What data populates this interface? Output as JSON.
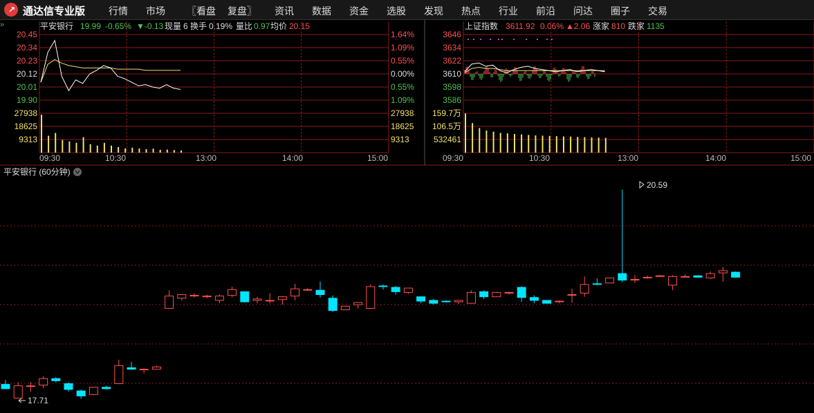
{
  "app": {
    "title": "通达信专业版"
  },
  "menu": [
    "行情",
    "市场",
    "〖看盘",
    "复盘〗",
    "资讯",
    "数据",
    "资金",
    "选股",
    "发现",
    "热点",
    "行业",
    "前沿",
    "问达",
    "圈子",
    "交易"
  ],
  "left_panel": {
    "name": "平安银行",
    "price": "19.99",
    "change_pct": "-0.65%",
    "change": "▼-0.13",
    "vol_label": "现量",
    "vol_value": "6",
    "turnover_label": "换手",
    "turnover_value": "0.19%",
    "ratio_label": "量比",
    "ratio_value": "0.97",
    "avg_label": "均价",
    "avg_value": "20.15",
    "price_ticks": [
      "20.45",
      "20.34",
      "20.23",
      "20.12",
      "20.01",
      "19.90"
    ],
    "pct_ticks": [
      "1.64%",
      "1.09%",
      "0.55%",
      "0.00%",
      "0.55%",
      "1.09%"
    ],
    "vol_ticks": [
      "27938",
      "18625",
      "9313"
    ],
    "time_ticks": [
      "09:30",
      "10:30",
      "13:00",
      "14:00",
      "15:00"
    ]
  },
  "right_panel": {
    "name": "上证指数",
    "value": "3611.92",
    "change_pct": "0.06%",
    "change": "▲2.06",
    "up_label": "涨家",
    "up_value": "810",
    "down_label": "跌家",
    "down_value": "1135",
    "price_ticks": [
      "3646",
      "3634",
      "3622",
      "3610",
      "3598",
      "3586"
    ],
    "vol_ticks": [
      "159.7万",
      "106.5万",
      "532461"
    ],
    "time_ticks": [
      "09:30",
      "10:30",
      "13:00",
      "14:00",
      "15:00"
    ]
  },
  "kline": {
    "title": "平安银行 (60分钟)",
    "high_label": "20.59",
    "low_label": "17.71"
  },
  "colors": {
    "up": "#ff5050",
    "down": "#00e5ff",
    "grid": "#8b1a1a",
    "avg": "#f4e16b",
    "price_line": "#ffffff",
    "green": "#4fc34f"
  },
  "chart_data": [
    {
      "type": "line",
      "title": "平安银行",
      "x": [
        "09:30",
        "09:36",
        "09:42",
        "09:48",
        "09:54",
        "10:00",
        "10:06",
        "10:12",
        "10:18",
        "10:24",
        "10:30",
        "10:36",
        "10:42",
        "10:48",
        "10:54",
        "11:00",
        "11:06",
        "11:12",
        "11:18",
        "11:24",
        "11:30"
      ],
      "series": [
        {
          "name": "price",
          "values": [
            20.05,
            20.3,
            20.4,
            20.1,
            19.98,
            20.07,
            20.04,
            20.12,
            20.15,
            20.19,
            20.17,
            20.1,
            20.08,
            20.05,
            20.02,
            20.03,
            20.01,
            20.0,
            20.03,
            20.0,
            19.99
          ]
        },
        {
          "name": "均价",
          "values": [
            20.05,
            20.2,
            20.24,
            20.21,
            20.19,
            20.18,
            20.17,
            20.17,
            20.17,
            20.17,
            20.17,
            20.16,
            20.16,
            20.16,
            20.16,
            20.15,
            20.15,
            20.15,
            20.15,
            20.15,
            20.15
          ]
        }
      ],
      "volume": [
        27000,
        12000,
        14000,
        9000,
        8000,
        7000,
        11000,
        6000,
        5000,
        7000,
        5000,
        4000,
        3000,
        3500,
        3000,
        2500,
        2800,
        2000,
        2200,
        1800,
        1500
      ],
      "ylim": [
        19.9,
        20.45
      ]
    },
    {
      "type": "line",
      "title": "上证指数",
      "x": [
        "09:30",
        "09:36",
        "09:42",
        "09:48",
        "09:54",
        "10:00",
        "10:06",
        "10:12",
        "10:18",
        "10:24",
        "10:30",
        "10:36",
        "10:42",
        "10:48",
        "10:54",
        "11:00",
        "11:06",
        "11:12",
        "11:18",
        "11:24",
        "11:30"
      ],
      "series": [
        {
          "name": "index",
          "values": [
            3612,
            3619,
            3620,
            3617,
            3618,
            3613,
            3611,
            3614,
            3616,
            3617,
            3615,
            3614,
            3613,
            3612,
            3613,
            3614,
            3612,
            3613,
            3614,
            3613,
            3612
          ]
        },
        {
          "name": "avg",
          "values": [
            3611,
            3615,
            3616,
            3615,
            3615,
            3614,
            3613,
            3613,
            3613,
            3613,
            3613,
            3613,
            3613,
            3613,
            3613,
            3613,
            3613,
            3613,
            3613,
            3613,
            3613
          ]
        }
      ],
      "volume": [
        1590000,
        1200000,
        1000000,
        900000,
        850000,
        800000,
        780000,
        760000,
        740000,
        720000,
        700000,
        690000,
        680000,
        670000,
        660000,
        650000,
        640000,
        630000,
        620000,
        610000,
        600000
      ],
      "ylim": [
        3586,
        3646
      ]
    },
    {
      "type": "candlestick",
      "title": "平安银行 (60分钟)",
      "candles": [
        {
          "o": 17.9,
          "h": 17.96,
          "l": 17.85,
          "c": 17.84
        },
        {
          "o": 17.71,
          "h": 17.93,
          "l": 17.71,
          "c": 17.88
        },
        {
          "o": 17.88,
          "h": 17.93,
          "l": 17.8,
          "c": 17.88
        },
        {
          "o": 17.89,
          "h": 18.01,
          "l": 17.85,
          "c": 17.98
        },
        {
          "o": 17.98,
          "h": 18.0,
          "l": 17.93,
          "c": 17.95
        },
        {
          "o": 17.91,
          "h": 17.93,
          "l": 17.8,
          "c": 17.83
        },
        {
          "o": 17.81,
          "h": 17.83,
          "l": 17.7,
          "c": 17.74
        },
        {
          "o": 17.76,
          "h": 17.86,
          "l": 17.75,
          "c": 17.86
        },
        {
          "o": 17.86,
          "h": 17.88,
          "l": 17.83,
          "c": 17.84
        },
        {
          "o": 17.91,
          "h": 18.24,
          "l": 17.91,
          "c": 18.16
        },
        {
          "o": 18.13,
          "h": 18.21,
          "l": 18.1,
          "c": 18.11
        },
        {
          "o": 18.11,
          "h": 18.12,
          "l": 18.05,
          "c": 18.11
        },
        {
          "o": 18.11,
          "h": 18.16,
          "l": 18.11,
          "c": 18.14
        },
        {
          "o": 18.95,
          "h": 19.2,
          "l": 18.95,
          "c": 19.12
        },
        {
          "o": 19.09,
          "h": 19.14,
          "l": 19.06,
          "c": 19.14
        },
        {
          "o": 19.13,
          "h": 19.16,
          "l": 19.1,
          "c": 19.13
        },
        {
          "o": 19.11,
          "h": 19.14,
          "l": 19.09,
          "c": 19.12
        },
        {
          "o": 19.06,
          "h": 19.14,
          "l": 19.02,
          "c": 19.12
        },
        {
          "o": 19.13,
          "h": 19.25,
          "l": 19.1,
          "c": 19.21
        },
        {
          "o": 19.18,
          "h": 19.18,
          "l": 19.03,
          "c": 19.04
        },
        {
          "o": 19.06,
          "h": 19.11,
          "l": 19.02,
          "c": 19.08
        },
        {
          "o": 19.06,
          "h": 19.16,
          "l": 19.02,
          "c": 19.06
        },
        {
          "o": 19.07,
          "h": 19.12,
          "l": 19.0,
          "c": 19.11
        },
        {
          "o": 19.12,
          "h": 19.29,
          "l": 19.06,
          "c": 19.22
        },
        {
          "o": 19.21,
          "h": 19.23,
          "l": 19.19,
          "c": 19.21
        },
        {
          "o": 19.2,
          "h": 19.32,
          "l": 19.1,
          "c": 19.14
        },
        {
          "o": 19.09,
          "h": 19.13,
          "l": 18.9,
          "c": 18.92
        },
        {
          "o": 18.93,
          "h": 18.98,
          "l": 18.93,
          "c": 18.98
        },
        {
          "o": 19.0,
          "h": 19.03,
          "l": 18.95,
          "c": 19.03
        },
        {
          "o": 18.95,
          "h": 19.28,
          "l": 18.95,
          "c": 19.25
        },
        {
          "o": 19.26,
          "h": 19.28,
          "l": 19.21,
          "c": 19.25
        },
        {
          "o": 19.24,
          "h": 19.26,
          "l": 19.14,
          "c": 19.18
        },
        {
          "o": 19.17,
          "h": 19.22,
          "l": 19.15,
          "c": 19.23
        },
        {
          "o": 19.11,
          "h": 19.11,
          "l": 19.02,
          "c": 19.05
        },
        {
          "o": 19.06,
          "h": 19.08,
          "l": 19.0,
          "c": 19.02
        },
        {
          "o": 19.05,
          "h": 19.06,
          "l": 19.03,
          "c": 19.04
        },
        {
          "o": 19.04,
          "h": 19.05,
          "l": 19.01,
          "c": 19.06
        },
        {
          "o": 19.02,
          "h": 19.2,
          "l": 19.02,
          "c": 19.17
        },
        {
          "o": 19.18,
          "h": 19.2,
          "l": 19.08,
          "c": 19.11
        },
        {
          "o": 19.11,
          "h": 19.18,
          "l": 19.11,
          "c": 19.17
        },
        {
          "o": 19.17,
          "h": 19.18,
          "l": 19.14,
          "c": 19.17
        },
        {
          "o": 19.24,
          "h": 19.25,
          "l": 19.04,
          "c": 19.1
        },
        {
          "o": 19.1,
          "h": 19.13,
          "l": 19.02,
          "c": 19.06
        },
        {
          "o": 19.06,
          "h": 19.04,
          "l": 19.02,
          "c": 19.02
        },
        {
          "o": 19.04,
          "h": 19.06,
          "l": 19.02,
          "c": 19.05
        },
        {
          "o": 19.14,
          "h": 19.22,
          "l": 19.03,
          "c": 19.14
        },
        {
          "o": 19.16,
          "h": 19.39,
          "l": 19.11,
          "c": 19.28
        },
        {
          "o": 19.29,
          "h": 19.36,
          "l": 19.27,
          "c": 19.28
        },
        {
          "o": 19.3,
          "h": 19.37,
          "l": 19.3,
          "c": 19.37
        },
        {
          "o": 19.43,
          "h": 20.59,
          "l": 19.31,
          "c": 19.34
        },
        {
          "o": 19.34,
          "h": 19.41,
          "l": 19.3,
          "c": 19.35
        },
        {
          "o": 19.37,
          "h": 19.4,
          "l": 19.36,
          "c": 19.38
        },
        {
          "o": 19.39,
          "h": 19.41,
          "l": 19.39,
          "c": 19.4
        },
        {
          "o": 19.27,
          "h": 19.41,
          "l": 19.2,
          "c": 19.39
        },
        {
          "o": 19.39,
          "h": 19.42,
          "l": 19.38,
          "c": 19.39
        },
        {
          "o": 19.4,
          "h": 19.41,
          "l": 19.38,
          "c": 19.38
        },
        {
          "o": 19.37,
          "h": 19.46,
          "l": 19.36,
          "c": 19.43
        },
        {
          "o": 19.44,
          "h": 19.52,
          "l": 19.32,
          "c": 19.47
        },
        {
          "o": 19.45,
          "h": 19.46,
          "l": 19.37,
          "c": 19.38
        }
      ],
      "ylim": [
        17.6,
        20.7
      ]
    }
  ]
}
